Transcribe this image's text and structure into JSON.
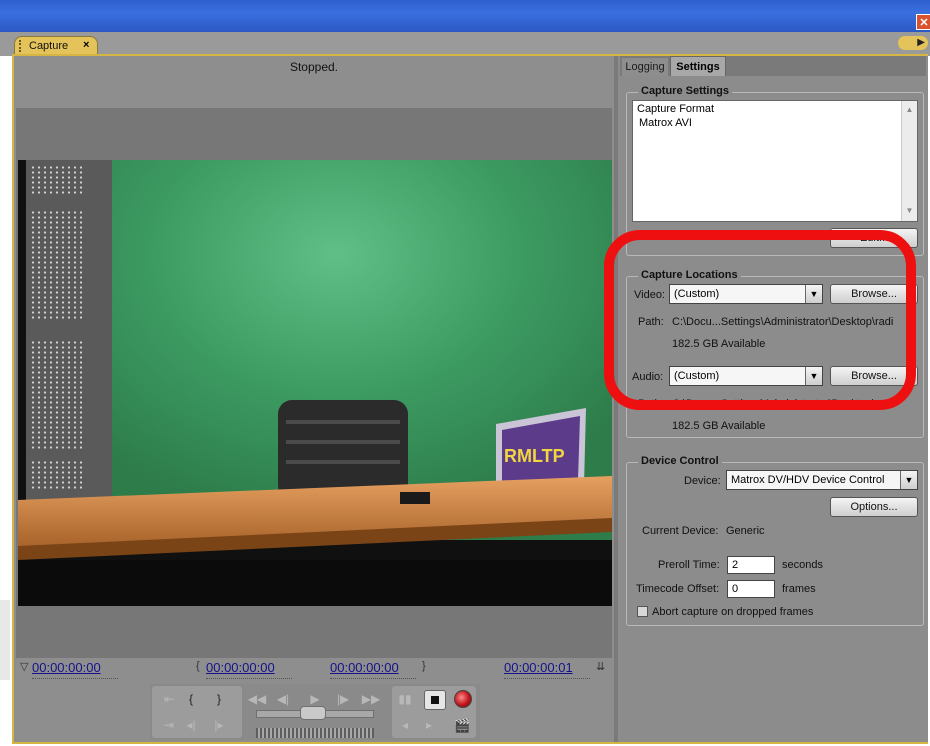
{
  "window": {
    "close_glyph": "✕"
  },
  "panel_tab": {
    "title": "Capture",
    "close_glyph": "×",
    "menu_glyph": "▶"
  },
  "monitor": {
    "status": "Stopped.",
    "video_logo_text": "RMLTP"
  },
  "timecodes": {
    "current": "00:00:00:00",
    "in_point": "00:00:00:00",
    "out_point": "00:00:00:00",
    "duration": "00:00:00:01"
  },
  "icons": {
    "current_marker": "▽",
    "in_marker": "{",
    "out_marker": "}",
    "duration_marker": "⇊",
    "set_in": "⇤",
    "set_out": "⇥",
    "goto_in": "◂|",
    "goto_out": "|▸",
    "rewind": "◀◀",
    "step_back": "◀|",
    "play": "▶",
    "step_forward": "|▶",
    "fast_forward": "▶▶",
    "pause": "▮▮",
    "slow_reverse": "◂",
    "slow_play": "▸",
    "scene_detect": "🎬"
  },
  "right_panel": {
    "tabs": [
      {
        "label": "Logging"
      },
      {
        "label": "Settings"
      }
    ],
    "capture_settings": {
      "title": "Capture Settings",
      "format_label": "Capture Format",
      "format_value": "Matrox AVI",
      "edit_button": "Edit..."
    },
    "capture_locations": {
      "title": "Capture Locations",
      "video_label": "Video:",
      "video_value": "(Custom)",
      "browse_video": "Browse...",
      "video_path_label": "Path:",
      "video_path": "C:\\Docu...Settings\\Administrator\\Desktop\\radi",
      "video_available": "182.5 GB Available",
      "audio_label": "Audio:",
      "audio_value": "(Custom)",
      "browse_audio": "Browse...",
      "audio_path_label": "Path:",
      "audio_path": "C:\\Docu...Settings\\Administrator\\Desktop\\radi",
      "audio_available": "182.5 GB Available"
    },
    "device_control": {
      "title": "Device Control",
      "device_label": "Device:",
      "device_value": "Matrox DV/HDV Device Control",
      "options_button": "Options...",
      "current_device_label": "Current Device:",
      "current_device_value": "Generic",
      "preroll_label": "Preroll Time:",
      "preroll_value": "2",
      "preroll_unit": "seconds",
      "tc_offset_label": "Timecode Offset:",
      "tc_offset_value": "0",
      "tc_offset_unit": "frames",
      "abort_label": "Abort capture on dropped frames",
      "abort_checked": false
    }
  },
  "colors": {
    "tab_accent": "#e4c35a",
    "panel_gray": "#8c8c8c",
    "timecode_blue": "#14128c",
    "annotation_red": "#ee1010"
  }
}
